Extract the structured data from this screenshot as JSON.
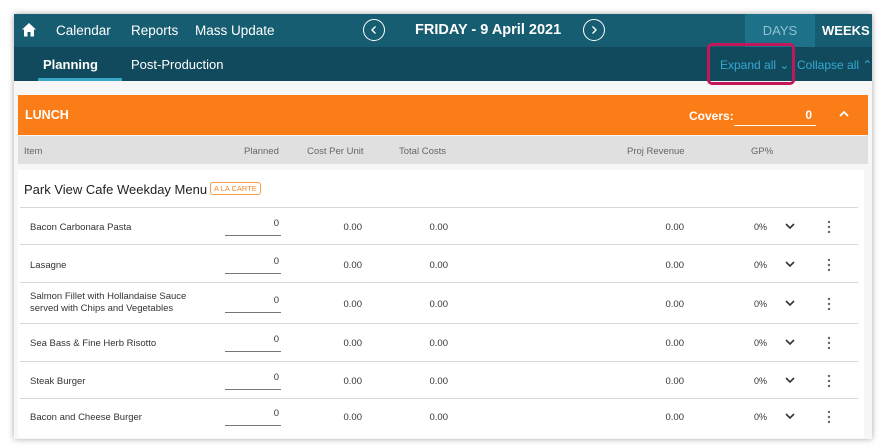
{
  "topnav": {
    "home_icon": "home-icon",
    "links": [
      "Calendar",
      "Reports",
      "Mass Update"
    ],
    "date": "FRIDAY - 9 April 2021",
    "prev_icon": "chevron-left-circle-icon",
    "next_icon": "chevron-right-circle-icon",
    "days_tab": "DAYS",
    "weeks_tab": "WEEKS"
  },
  "subnav": {
    "tabs": [
      "Planning",
      "Post-Production"
    ],
    "active_tab": "Planning",
    "expand_all": "Expand all ⌄",
    "collapse_all": "Collapse all ⌃"
  },
  "section": {
    "title": "LUNCH",
    "covers_label": "Covers:",
    "covers_value": "0"
  },
  "columns": [
    "Item",
    "Planned",
    "Cost Per Unit",
    "Total Costs",
    "Proj Revenue",
    "GP%"
  ],
  "menu": {
    "title": "Park View Cafe Weekday Menu",
    "badge": "A LA CARTE",
    "items": [
      {
        "name": "Bacon Carbonara Pasta",
        "planned": "0",
        "cost_per_unit": "0.00",
        "total_costs": "0.00",
        "proj_revenue": "0.00",
        "gp": "0%"
      },
      {
        "name": "Lasagne",
        "planned": "0",
        "cost_per_unit": "0.00",
        "total_costs": "0.00",
        "proj_revenue": "0.00",
        "gp": "0%"
      },
      {
        "name": "Salmon Fillet with Hollandaise Sauce",
        "name2": "served with Chips and Vegetables",
        "planned": "0",
        "cost_per_unit": "0.00",
        "total_costs": "0.00",
        "proj_revenue": "0.00",
        "gp": "0%"
      },
      {
        "name": "Sea Bass & Fine Herb Risotto",
        "planned": "0",
        "cost_per_unit": "0.00",
        "total_costs": "0.00",
        "proj_revenue": "0.00",
        "gp": "0%"
      },
      {
        "name": "Steak Burger",
        "planned": "0",
        "cost_per_unit": "0.00",
        "total_costs": "0.00",
        "proj_revenue": "0.00",
        "gp": "0%"
      },
      {
        "name": "Bacon and Cheese Burger",
        "planned": "0",
        "cost_per_unit": "0.00",
        "total_costs": "0.00",
        "proj_revenue": "0.00",
        "gp": "0%"
      }
    ]
  },
  "colors": {
    "nav_bg": "#165d72",
    "subnav_bg": "#104a5c",
    "accent_blue": "#35a9d0",
    "section_orange": "#fb7d18",
    "highlight": "#c2185b"
  }
}
